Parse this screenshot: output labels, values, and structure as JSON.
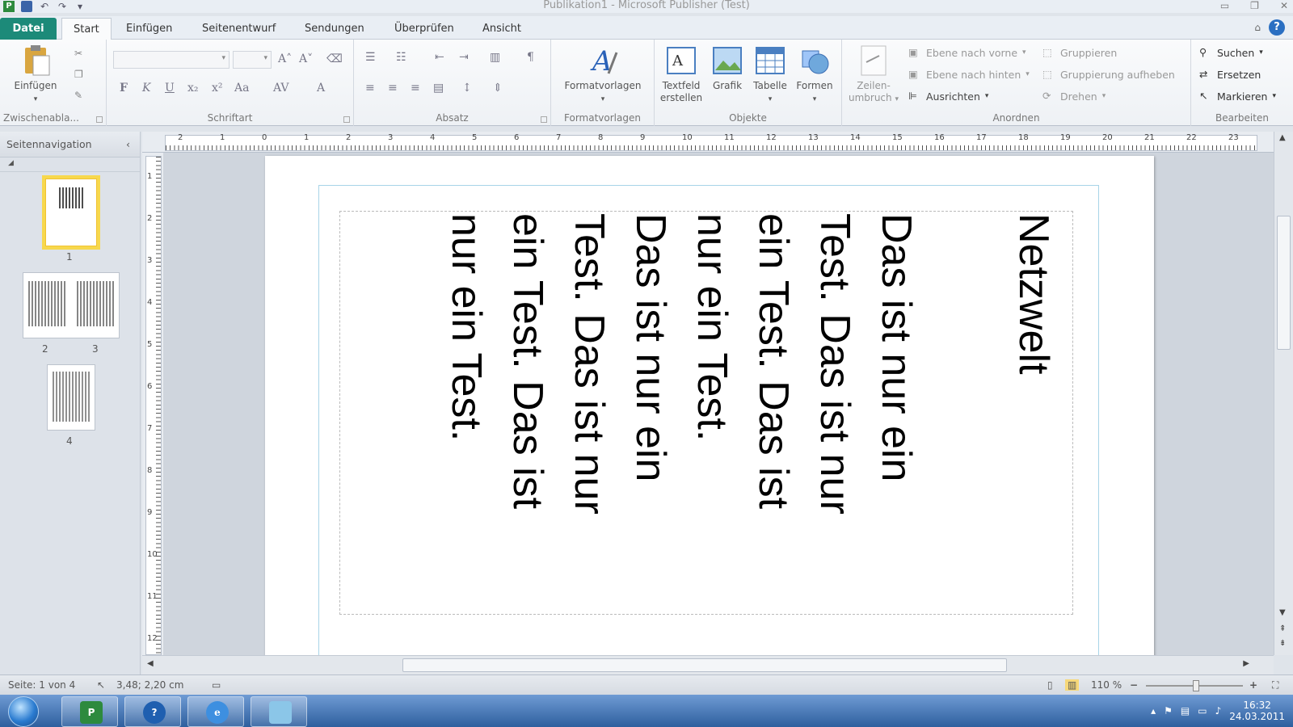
{
  "window": {
    "title": "Publikation1 - Microsoft Publisher (Test)",
    "controls": [
      "▭",
      "❐",
      "✕"
    ]
  },
  "quick_access": {
    "undo_glyph": "↶",
    "redo_glyph": "↷",
    "customize_glyph": "▾"
  },
  "tabs": [
    {
      "label": "Datei",
      "active": false,
      "type": "file"
    },
    {
      "label": "Start",
      "active": true
    },
    {
      "label": "Einfügen",
      "active": false
    },
    {
      "label": "Seitenentwurf",
      "active": false
    },
    {
      "label": "Sendungen",
      "active": false
    },
    {
      "label": "Überprüfen",
      "active": false
    },
    {
      "label": "Ansicht",
      "active": false
    }
  ],
  "ribbon": {
    "groups": {
      "clipboard": "Zwischenabla...",
      "font": "Schriftart",
      "paragraph": "Absatz",
      "styles": "Formatvorlagen",
      "objects": "Objekte",
      "arrange": "Anordnen",
      "edit": "Bearbeiten"
    },
    "buttons": {
      "paste": "Einfügen",
      "styles": "Formatvorlagen",
      "textbox_line1": "Textfeld",
      "textbox_line2": "erstellen",
      "picture": "Grafik",
      "table": "Tabelle",
      "shapes": "Formen",
      "wrap_line1": "Zeilen-",
      "wrap_line2": "umbruch",
      "bring_forward": "Ebene nach vorne",
      "send_backward": "Ebene nach hinten",
      "align": "Ausrichten",
      "group": "Gruppieren",
      "ungroup": "Gruppierung aufheben",
      "rotate": "Drehen",
      "find": "Suchen",
      "replace": "Ersetzen",
      "select": "Markieren"
    },
    "font_format_labels": {
      "bold": "F",
      "italic": "K",
      "underline": "U",
      "subscript": "x₂",
      "superscript": "x²",
      "case": "Aa",
      "grow": "A˄",
      "shrink": "A˅",
      "spacing": "AV",
      "color": "A",
      "pilcrow": "¶"
    }
  },
  "navigation": {
    "title": "Seitennavigation",
    "collapse_glyph": "‹",
    "pages": [
      "1",
      "2",
      "3",
      "4"
    ]
  },
  "rulers": {
    "horizontal_labels": [
      "2",
      "1",
      "0",
      "1",
      "2",
      "3",
      "4",
      "5",
      "6",
      "7",
      "8",
      "9",
      "10",
      "11",
      "12",
      "13",
      "14",
      "15",
      "16",
      "17",
      "18",
      "19",
      "20",
      "21",
      "22",
      "23"
    ],
    "vertical_labels": [
      "1",
      "2",
      "3",
      "4",
      "5",
      "6",
      "7",
      "8",
      "9",
      "10",
      "11",
      "12"
    ]
  },
  "document": {
    "columns": [
      "Netzwelt",
      "Das ist nur ein",
      "Test. Das ist nur",
      "ein Test. Das ist",
      "nur ein Test.",
      "Das ist nur ein",
      "Test. Das ist nur",
      "ein Test. Das ist",
      "nur ein Test."
    ]
  },
  "status": {
    "page": "Seite: 1 von 4",
    "position": "3,48; 2,20 cm",
    "zoom": "110 %",
    "zoom_minus": "−",
    "zoom_plus": "+"
  },
  "taskbar": {
    "time": "16:32",
    "date": "24.03.2011"
  }
}
